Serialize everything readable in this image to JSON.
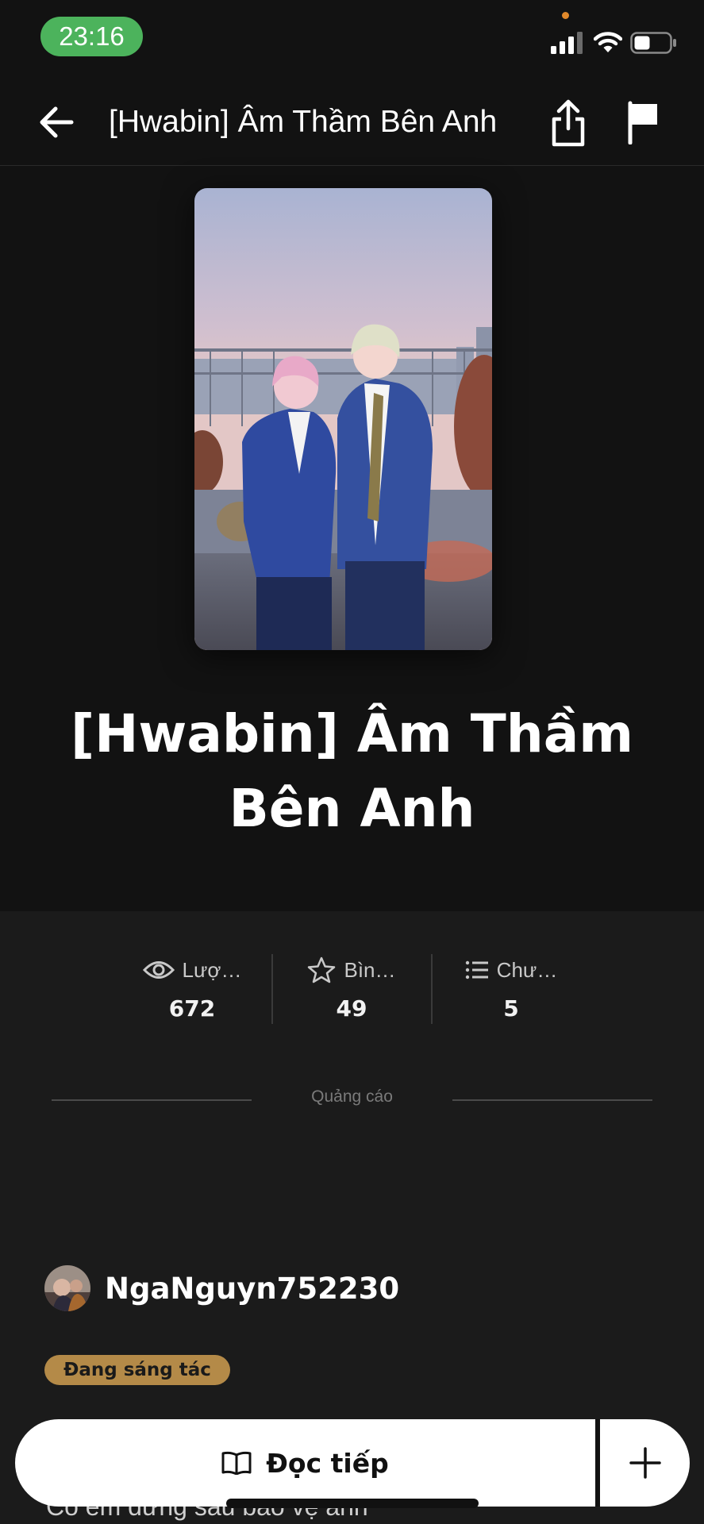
{
  "status_bar": {
    "time": "23:16"
  },
  "nav": {
    "title": "[Hwabin] Âm Thầm Bên Anh"
  },
  "story": {
    "title": "[Hwabin] Âm Thầm Bên Anh",
    "status_badge": "Đang sáng tác",
    "description_peek": "Có em đứng sau bảo vệ anh"
  },
  "stats": [
    {
      "icon": "eye-icon",
      "label": "Lượ…",
      "value": "672"
    },
    {
      "icon": "star-icon",
      "label": "Bìn…",
      "value": "49"
    },
    {
      "icon": "list-icon",
      "label": "Chư…",
      "value": "5"
    }
  ],
  "ad": {
    "label": "Quảng cáo"
  },
  "author": {
    "name": "NgaNguyn752230"
  },
  "actions": {
    "continue_label": "Đọc tiếp"
  },
  "colors": {
    "background": "#121212",
    "panel": "#1b1b1b",
    "status_badge": "#b48a48",
    "time_pill": "#4cb35c"
  }
}
